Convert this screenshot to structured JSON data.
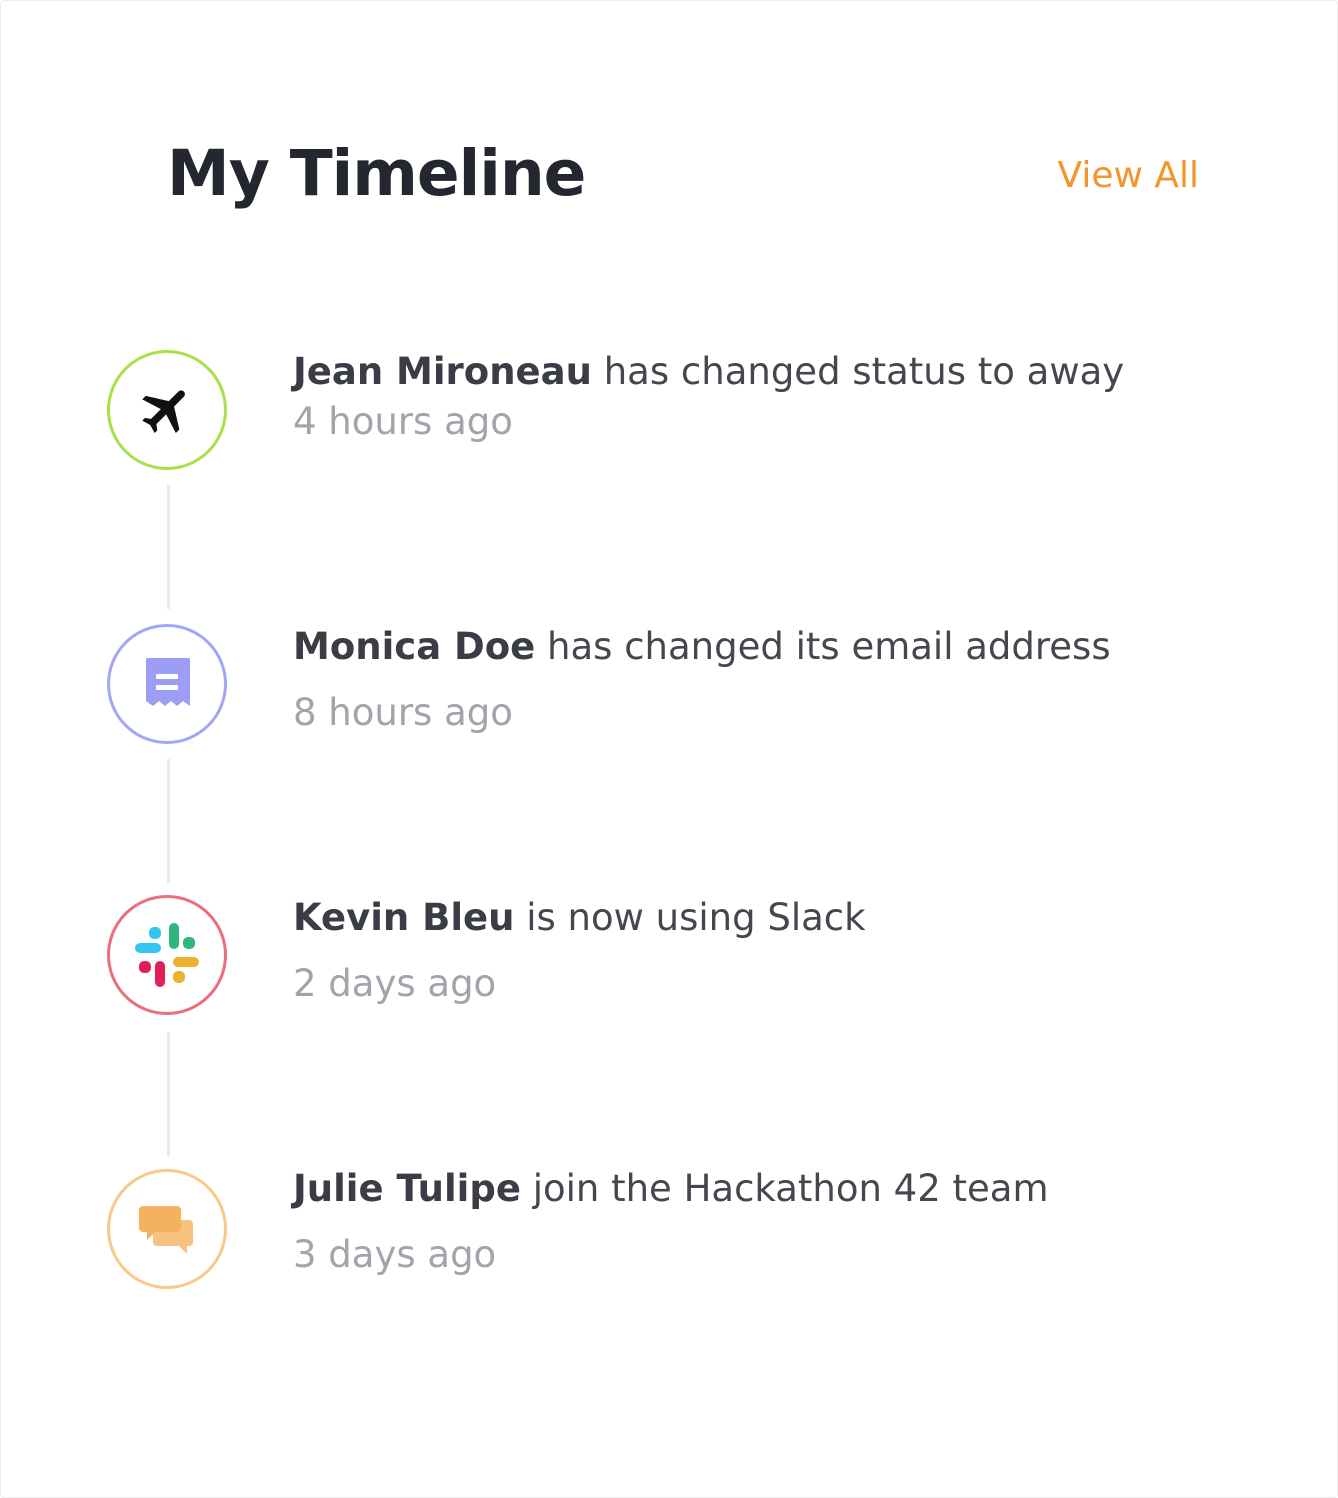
{
  "header": {
    "title": "My Timeline",
    "view_all_label": "View All",
    "accent_color": "#f2962c"
  },
  "timeline": [
    {
      "icon": "airplane-icon",
      "ring_color": "#a8e04a",
      "name": "Jean Mironeau",
      "action": "has changed status to away",
      "time": "4 hours ago"
    },
    {
      "icon": "receipt-icon",
      "ring_color": "#a3a6f5",
      "name": "Monica Doe",
      "action": "has changed its email address",
      "time": "8 hours ago"
    },
    {
      "icon": "slack-icon",
      "ring_color": "#ea6e7e",
      "name": "Kevin Bleu",
      "action": "is now using Slack",
      "time": "2 days ago"
    },
    {
      "icon": "chat-bubbles-icon",
      "ring_color": "#f8c98a",
      "name": "Julie Tulipe",
      "action": "join the Hackathon 42 team",
      "time": "3 days ago"
    }
  ]
}
